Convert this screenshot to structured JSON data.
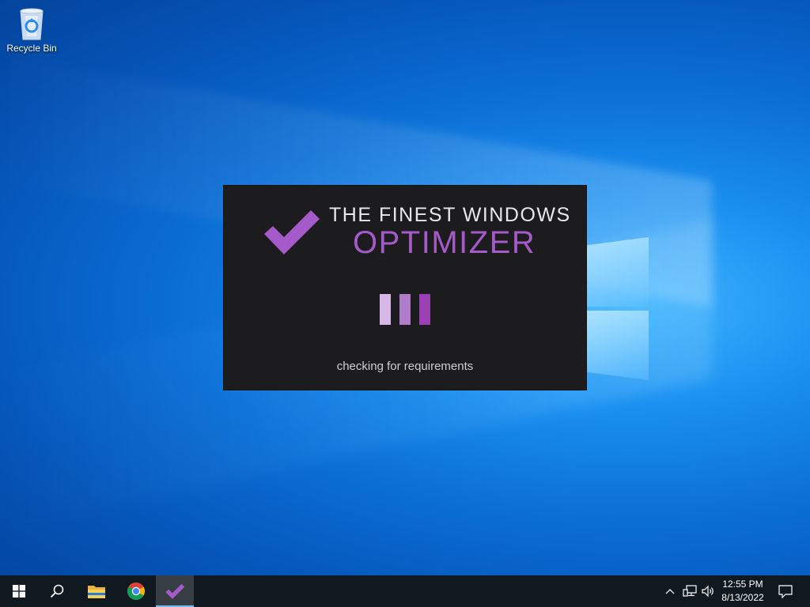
{
  "desktop": {
    "icons": [
      {
        "label": "Recycle Bin",
        "icon": "recycle-bin-icon"
      }
    ]
  },
  "splash": {
    "title_line1": "THE FINEST WINDOWS",
    "title_line2": "OPTIMIZER",
    "status_text": "checking for requirements",
    "logo_icon": "checkmark-icon",
    "colors": {
      "background": "#1c1b1e",
      "accent": "#a55ac9",
      "bar_light": "#d6b7e6",
      "bar_mid": "#b07ccc",
      "bar_dark": "#9b3fb5"
    }
  },
  "taskbar": {
    "items": [
      {
        "name": "start",
        "icon": "windows-start-icon"
      },
      {
        "name": "search",
        "icon": "search-icon"
      },
      {
        "name": "file-explorer",
        "icon": "folder-icon"
      },
      {
        "name": "chrome",
        "icon": "chrome-icon"
      },
      {
        "name": "optimizer",
        "icon": "checkmark-icon",
        "active": true
      }
    ],
    "tray": {
      "icons": [
        "chevron-up-icon",
        "network-icon",
        "volume-icon"
      ],
      "time": "12:55 PM",
      "date": "8/13/2022",
      "notification_icon": "notification-icon"
    }
  }
}
